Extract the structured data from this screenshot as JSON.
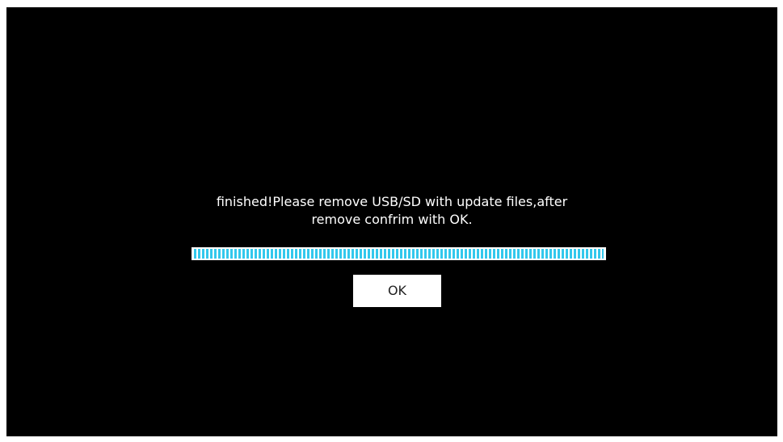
{
  "dialog": {
    "message_line1": "finished!Please remove USB/SD with update files,after",
    "message_line2": "remove confrim with OK.",
    "progress_percent": 100,
    "ok_label": "OK"
  },
  "colors": {
    "background": "#000000",
    "text": "#ffffff",
    "progress_fill": "#33c8ec",
    "progress_track": "#ffffff",
    "button_bg": "#ffffff",
    "button_text": "#222222"
  }
}
